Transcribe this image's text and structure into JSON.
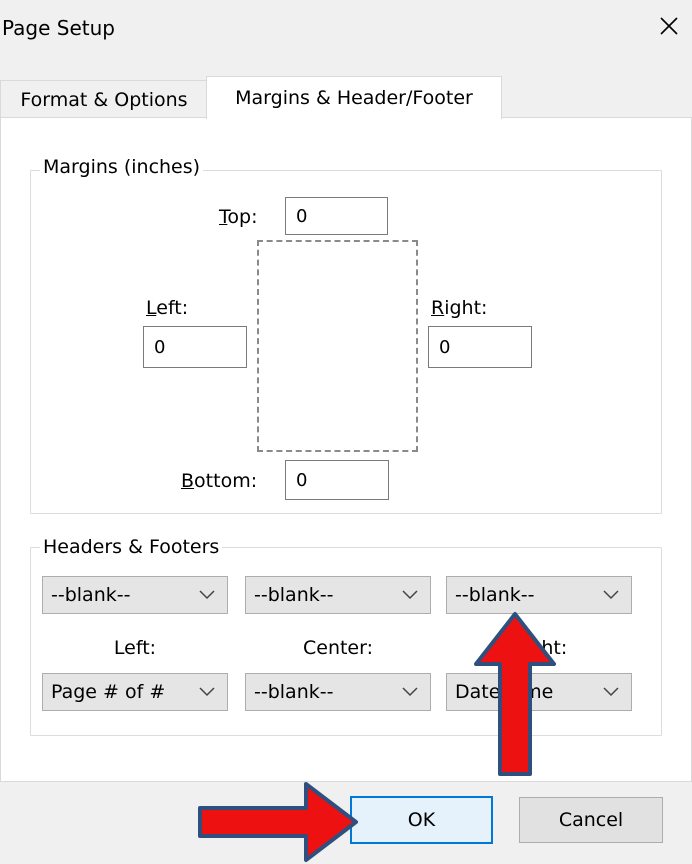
{
  "dialog": {
    "title": "Page Setup"
  },
  "tabs": [
    {
      "label": "Format & Options"
    },
    {
      "label": "Margins & Header/Footer"
    }
  ],
  "margins": {
    "legend": "Margins (inches)",
    "top_label": "Top:",
    "top_value": "0",
    "left_label": "Left:",
    "left_value": "0",
    "right_label": "Right:",
    "right_value": "0",
    "bottom_label": "Bottom:",
    "bottom_value": "0"
  },
  "headers_footers": {
    "legend": "Headers & Footers",
    "header_left": "--blank--",
    "header_center": "--blank--",
    "header_right": "--blank--",
    "label_left": "Left:",
    "label_center": "Center:",
    "label_right": "Right:",
    "footer_left": "Page # of #",
    "footer_center": "--blank--",
    "footer_right": "Date/Time"
  },
  "buttons": {
    "ok": "OK",
    "cancel": "Cancel"
  },
  "colors": {
    "arrow_fill": "#ee1111",
    "arrow_stroke": "#2f4f7f",
    "ok_border": "#0078d7"
  },
  "icons": [
    "close-icon",
    "chevron-down-icon",
    "up-arrow-annotation",
    "right-arrow-annotation"
  ]
}
